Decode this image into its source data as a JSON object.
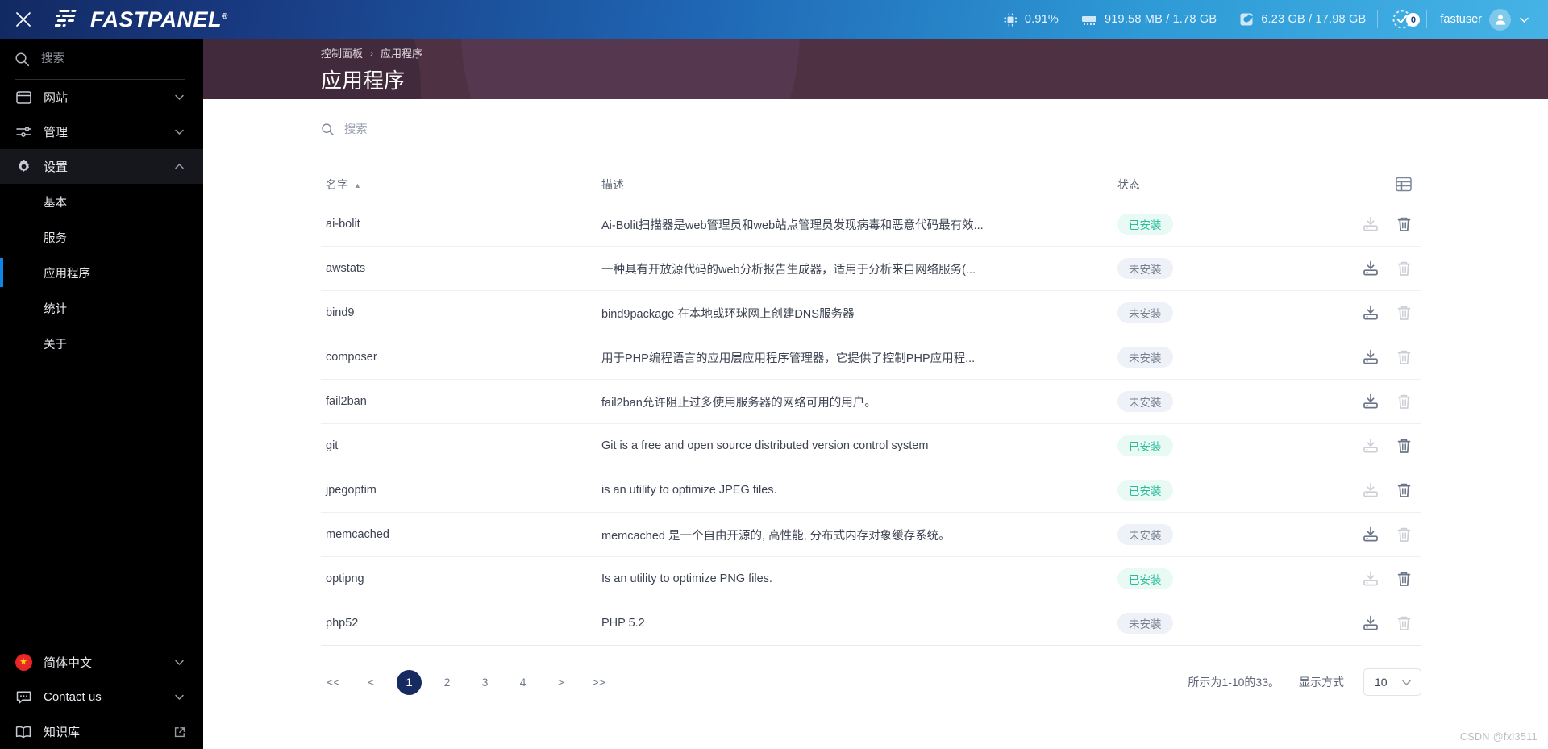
{
  "topbar": {
    "close_label": "close-window",
    "brand": "FASTPANEL",
    "brand_tm": "®",
    "cpu": "0.91%",
    "memory": "919.58 MB / 1.78 GB",
    "disk": "6.23 GB / 17.98 GB",
    "notifications_count": "0",
    "user": "fastuser"
  },
  "sidebar": {
    "search_placeholder": "搜索",
    "items": [
      {
        "label": "网站",
        "icon": "browser-window-icon",
        "expandable": true
      },
      {
        "label": "管理",
        "icon": "sliders-icon",
        "expandable": true
      },
      {
        "label": "设置",
        "icon": "gear-icon",
        "expandable": true,
        "expanded": true
      }
    ],
    "settings_children": [
      {
        "label": "基本",
        "active": false
      },
      {
        "label": "服务",
        "active": false
      },
      {
        "label": "应用程序",
        "active": true
      },
      {
        "label": "统计",
        "active": false
      },
      {
        "label": "关于",
        "active": false
      }
    ],
    "bottom": [
      {
        "label": "简体中文",
        "icon": "china-flag-icon",
        "trailing": "chevron-down-icon"
      },
      {
        "label": "Contact us",
        "icon": "chat-bubble-icon",
        "trailing": "chevron-down-icon"
      },
      {
        "label": "知识库",
        "icon": "book-icon",
        "trailing": "external-link-icon"
      }
    ]
  },
  "banner": {
    "breadcrumb_root": "控制面板",
    "breadcrumb_sep": "›",
    "breadcrumb_current": "应用程序",
    "title": "应用程序"
  },
  "toolbar": {
    "search_placeholder": "搜索"
  },
  "table": {
    "columns": {
      "name": "名字",
      "description": "描述",
      "status": "状态"
    },
    "sort_indicator": "▲",
    "grid_icon": "table-settings-icon",
    "status_labels": {
      "installed": "已安装",
      "not_installed": "未安装"
    },
    "rows": [
      {
        "name": "ai-bolit",
        "description": "Ai-Bolit扫描器是web管理员和web站点管理员发现病毒和恶意代码最有效...",
        "status": "已安装",
        "installed": true
      },
      {
        "name": "awstats",
        "description": "一种具有开放源代码的web分析报告生成器，适用于分析来自网络服务(...",
        "status": "未安装",
        "installed": false
      },
      {
        "name": "bind9",
        "description": "bind9package 在本地或环球网上创建DNS服务器",
        "status": "未安装",
        "installed": false
      },
      {
        "name": "composer",
        "description": "用于PHP编程语言的应用层应用程序管理器，它提供了控制PHP应用程...",
        "status": "未安装",
        "installed": false
      },
      {
        "name": "fail2ban",
        "description": "fail2ban允许阻止过多使用服务器的网络可用的用户。",
        "status": "未安装",
        "installed": false
      },
      {
        "name": "git",
        "description": "Git is a free and open source distributed version control system",
        "status": "已安装",
        "installed": true
      },
      {
        "name": "jpegoptim",
        "description": "is an utility to optimize JPEG files.",
        "status": "已安装",
        "installed": true
      },
      {
        "name": "memcached",
        "description": "memcached 是一个自由开源的, 高性能, 分布式内存对象缓存系统。",
        "status": "未安装",
        "installed": false
      },
      {
        "name": "optipng",
        "description": "Is an utility to optimize PNG files.",
        "status": "已安装",
        "installed": true
      },
      {
        "name": "php52",
        "description": "PHP 5.2",
        "status": "未安装",
        "installed": false
      }
    ]
  },
  "footer": {
    "pages": [
      "<<",
      "<",
      "1",
      "2",
      "3",
      "4",
      ">",
      ">>"
    ],
    "active_page": "1",
    "showing_text": "所示为1-10的33。",
    "per_page_label": "显示方式",
    "per_page_value": "10"
  },
  "watermark": "CSDN @fxl3511",
  "colors": {
    "topbar_start": "#122a63",
    "topbar_end": "#46b3e6",
    "banner": "#4e3244",
    "sidebar": "#000000",
    "active_accent": "#0c87e8",
    "page_active": "#182a62",
    "installed_badge_bg": "#e8faf3",
    "installed_badge_fg": "#2bbd9a",
    "not_installed_badge_bg": "#eef1f7",
    "not_installed_badge_fg": "#77808f"
  }
}
